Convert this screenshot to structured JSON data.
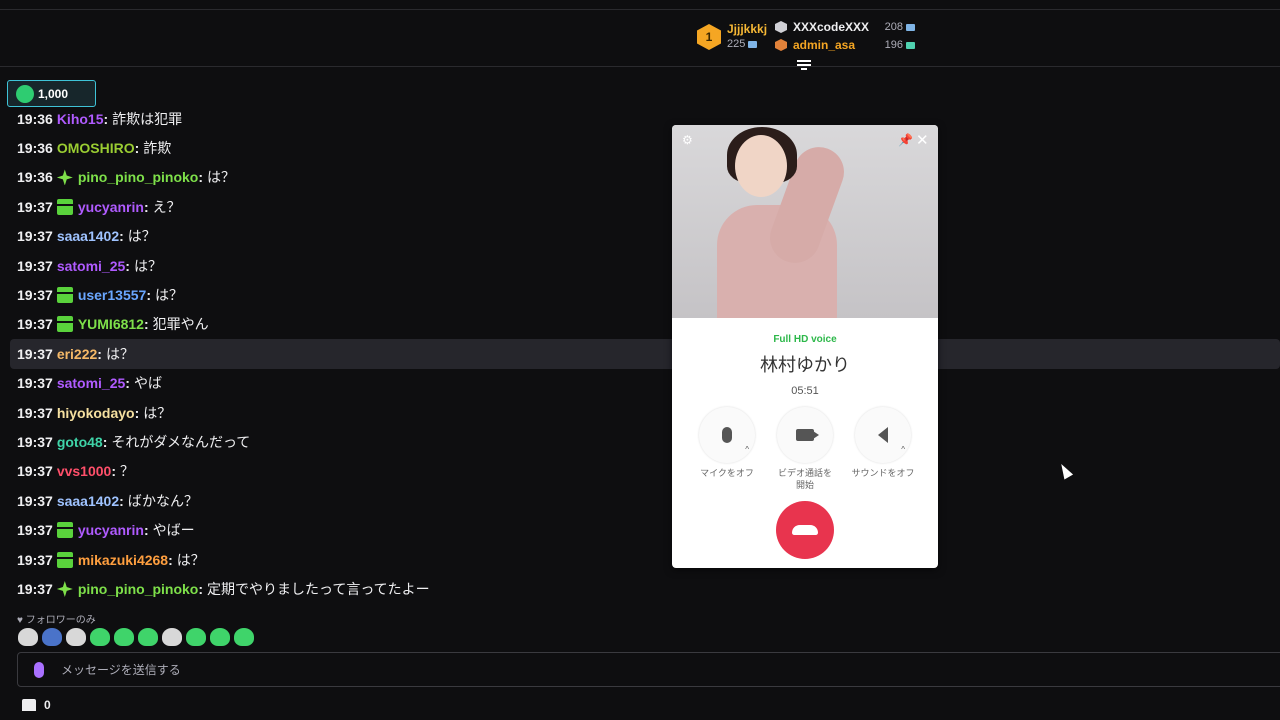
{
  "leaderboard": {
    "first": {
      "rank": "1",
      "name": "Jjjjkkkj",
      "count": "225"
    },
    "rows": [
      {
        "name": "XXXcodeXXX",
        "count": "208",
        "color": "#efeff1"
      },
      {
        "name": "admin_asa",
        "count": "196",
        "color": "#f5a623"
      }
    ]
  },
  "hype": {
    "value": "1,000"
  },
  "chat": [
    {
      "time": "19:36",
      "badge": "",
      "user": "Kiho15",
      "color": "#b05bff",
      "text": "詐欺は犯罪"
    },
    {
      "time": "19:36",
      "badge": "",
      "user": "OMOSHIRO",
      "color": "#9acd32",
      "text": "詐欺"
    },
    {
      "time": "19:36",
      "badge": "sparkle",
      "user": "pino_pino_pinoko",
      "color": "#7ee04a",
      "text": "は？"
    },
    {
      "time": "19:37",
      "badge": "gift",
      "user": "yucyanrin",
      "color": "#b05bff",
      "text": "え？"
    },
    {
      "time": "19:37",
      "badge": "",
      "user": "saaa1402",
      "color": "#9fc3ff",
      "text": "は？"
    },
    {
      "time": "19:37",
      "badge": "",
      "user": "satomi_25",
      "color": "#b05bff",
      "text": "は？"
    },
    {
      "time": "19:37",
      "badge": "gift",
      "user": "user13557",
      "color": "#6aa7ff",
      "text": "は？"
    },
    {
      "time": "19:37",
      "badge": "gift",
      "user": "YUMI6812",
      "color": "#7ee04a",
      "text": "犯罪やん"
    },
    {
      "time": "19:37",
      "badge": "",
      "user": "eri222",
      "color": "#f5b968",
      "text": "は？",
      "highlight": true
    },
    {
      "time": "19:37",
      "badge": "",
      "user": "satomi_25",
      "color": "#b05bff",
      "text": "やば"
    },
    {
      "time": "19:37",
      "badge": "",
      "user": "hiyokodayo",
      "color": "#f5e0a0",
      "text": "は？"
    },
    {
      "time": "19:37",
      "badge": "",
      "user": "goto48",
      "color": "#3fd4a8",
      "text": "それがダメなんだって"
    },
    {
      "time": "19:37",
      "badge": "",
      "user": "vvs1000",
      "color": "#ff4f6a",
      "text": "？"
    },
    {
      "time": "19:37",
      "badge": "",
      "user": "saaa1402",
      "color": "#9fc3ff",
      "text": "ばかなん？"
    },
    {
      "time": "19:37",
      "badge": "gift",
      "user": "yucyanrin",
      "color": "#b05bff",
      "text": "やばー"
    },
    {
      "time": "19:37",
      "badge": "gift",
      "user": "mikazuki4268",
      "color": "#ff9f3f",
      "text": "は？"
    },
    {
      "time": "19:37",
      "badge": "sparkle",
      "user": "pino_pino_pinoko",
      "color": "#7ee04a",
      "text": "定期でやりましたって言ってたよー"
    }
  ],
  "chat_settings": {
    "follow_only": "フォロワーのみ"
  },
  "input": {
    "placeholder": "メッセージを送信する"
  },
  "store": {
    "count": "0"
  },
  "call": {
    "quality": "Full HD voice",
    "name": "林村ゆかり",
    "duration": "05:51",
    "buttons": {
      "mic": "マイクをオフ",
      "video": "ビデオ通話を開始",
      "sound": "サウンドをオフ"
    }
  },
  "colors": {
    "accent": "#a970ff",
    "hangup": "#e8344e",
    "quality": "#2db84a"
  }
}
